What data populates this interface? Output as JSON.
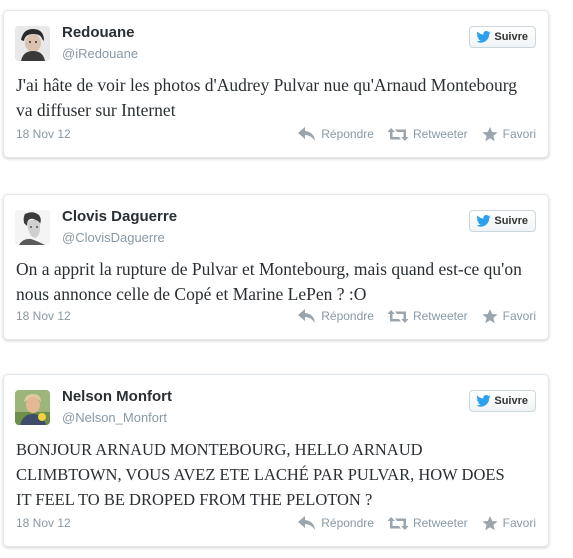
{
  "colors": {
    "bird": "#2ea1ec",
    "action_icon": "#9aa5ae",
    "meta_text": "#8899a6"
  },
  "icons": {
    "follow": "twitter-bird-icon",
    "reply": "reply-arrow-icon",
    "retweet": "retweet-icon",
    "favorite": "star-icon"
  },
  "tweets": [
    {
      "name": "Redouane",
      "handle": "@iRedouane",
      "follow_label": "Suivre",
      "text": "J'ai hâte de voir les photos d'Audrey Pulvar nue qu'Arnaud Montebourg va diffuser sur Internet",
      "date": "18 Nov 12",
      "reply_label": "Répondre",
      "retweet_label": "Retweeter",
      "favorite_label": "Favori"
    },
    {
      "name": "Clovis Daguerre",
      "handle": "@ClovisDaguerre",
      "follow_label": "Suivre",
      "text": "On a apprit la rupture de Pulvar et Montebourg, mais quand est-ce qu'on nous annonce celle de Copé et Marine LePen ? :O",
      "date": "18 Nov 12",
      "reply_label": "Répondre",
      "retweet_label": "Retweeter",
      "favorite_label": "Favori"
    },
    {
      "name": "Nelson Monfort",
      "handle": "@Nelson_Monfort",
      "follow_label": "Suivre",
      "text": "BONJOUR ARNAUD MONTEBOURG, HELLO ARNAUD CLIMBTOWN, VOUS AVEZ ETE LACHÉ PAR PULVAR, HOW DOES IT FEEL TO BE DROPED FROM THE PELOTON ?",
      "date": "18 Nov 12",
      "reply_label": "Répondre",
      "retweet_label": "Retweeter",
      "favorite_label": "Favori"
    }
  ]
}
